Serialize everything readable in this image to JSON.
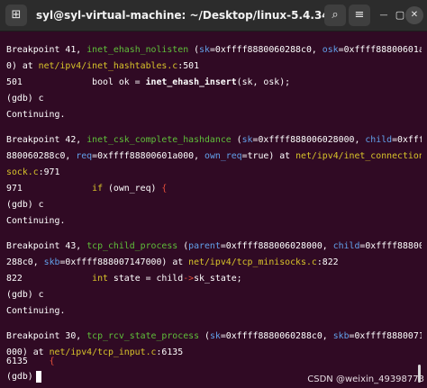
{
  "window": {
    "title": "syl@syl-virtual-machine: ~/Desktop/linux-5.4.34",
    "new_tab_icon": "⊞",
    "search_icon": "⌕",
    "menu_icon": "≡",
    "minimize_icon": "—",
    "maximize_icon": "▢",
    "close_icon": "✕"
  },
  "terminal": {
    "l01a": "Breakpoint 41, ",
    "l01b": "inet_ehash_nolisten",
    "l01c": " (",
    "l01d": "sk",
    "l01e": "=0xffff8880060288c0, ",
    "l01f": "osk",
    "l01g": "=0xffff88800601a00",
    "l02a": "0) at ",
    "l02b": "net/ipv4/inet_hashtables.c",
    "l02c": ":501",
    "l03a": "501             bool ok = ",
    "l03b": "inet_ehash_insert",
    "l03c": "(sk, osk);",
    "l04": "(gdb) c",
    "l05": "Continuing.",
    "l07a": "Breakpoint 42, ",
    "l07b": "inet_csk_complete_hashdance",
    "l07c": " (",
    "l07d": "sk",
    "l07e": "=0xffff888006028000, ",
    "l07f": "child",
    "l07g": "=0xffff8",
    "l08a": "880060288c0, ",
    "l08b": "req",
    "l08c": "=0xffff88800601a000, ",
    "l08d": "own_req",
    "l08e": "=true) at ",
    "l08f": "net/ipv4/inet_connection_",
    "l09a": "sock.c",
    "l09b": ":971",
    "l10a": "971             ",
    "l10b": "if",
    "l10c": " (own_req) ",
    "l10d": "{",
    "l11": "(gdb) c",
    "l12": "Continuing.",
    "l14a": "Breakpoint 43, ",
    "l14b": "tcp_child_process",
    "l14c": " (",
    "l14d": "parent",
    "l14e": "=0xffff888006028000, ",
    "l14f": "child",
    "l14g": "=0xffff8880060",
    "l15a": "288c0, ",
    "l15b": "skb",
    "l15c": "=0xffff888007147000) at ",
    "l15d": "net/ipv4/tcp_minisocks.c",
    "l15e": ":822",
    "l16a": "822             ",
    "l16b": "int",
    "l16c": " state = child",
    "l16d": "->",
    "l16e": "sk_state;",
    "l17": "(gdb) c",
    "l18": "Continuing.",
    "l20a": "Breakpoint 30, ",
    "l20b": "tcp_rcv_state_process",
    "l20c": " (",
    "l20d": "sk",
    "l20e": "=0xffff8880060288c0, ",
    "l20f": "skb",
    "l20g": "=0xffff888007147",
    "l21a": "000) at ",
    "l21b": "net/ipv4/tcp_input.c",
    "l21c": ":6135",
    "l22a": "6135    ",
    "l22b": "{",
    "l23": "(gdb) "
  },
  "watermark": "CSDN @weixin_49398773",
  "colors": {
    "terminal_bg": "#300a24",
    "function": "#5fbf3a",
    "argument": "#62a0ea",
    "path_keyword": "#d7c32a",
    "operator": "#e44e3a"
  }
}
